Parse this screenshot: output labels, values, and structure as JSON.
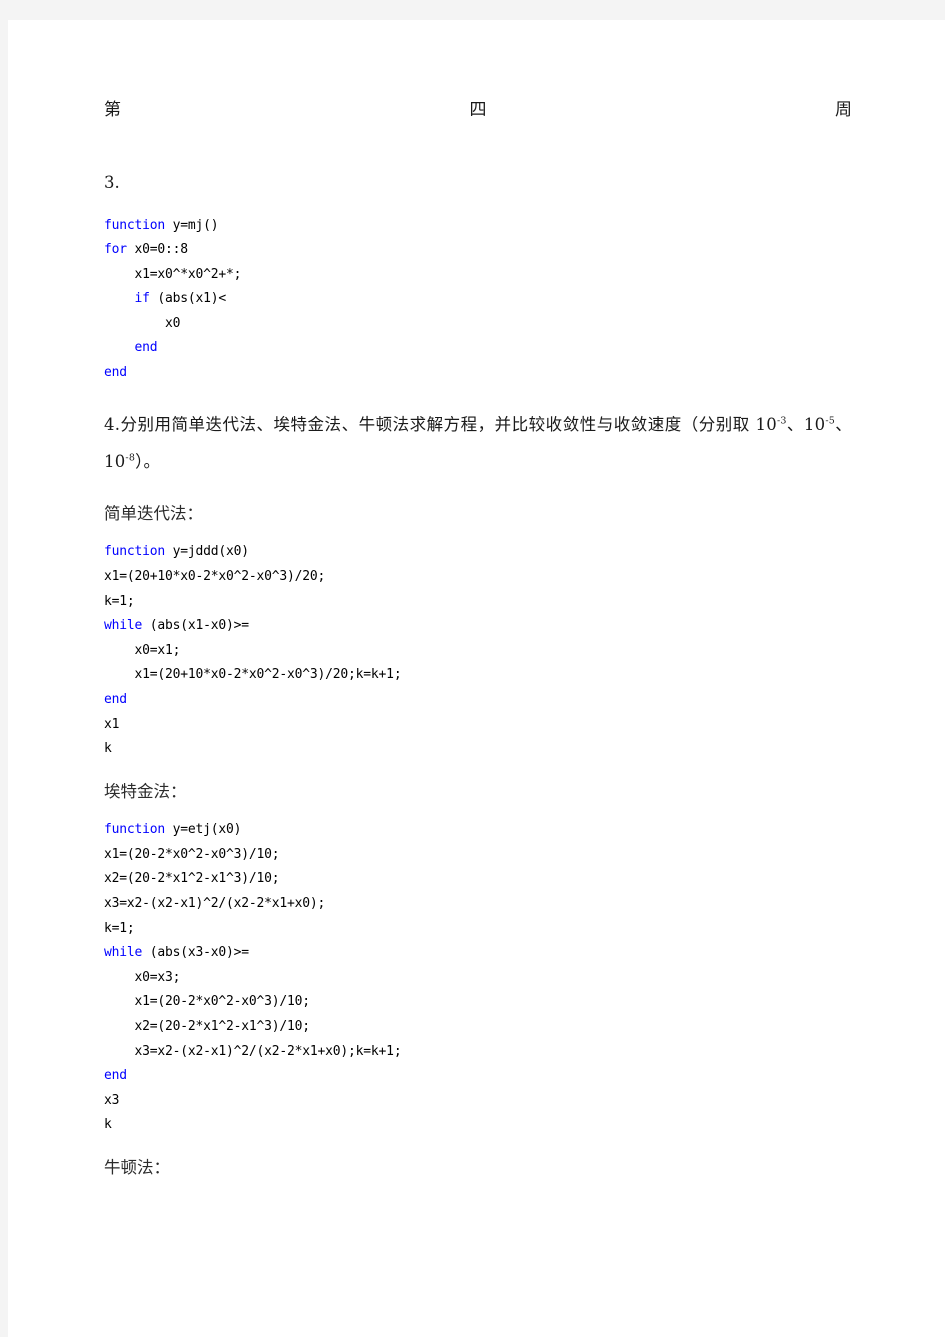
{
  "header": {
    "left": "第",
    "center": "四",
    "right": "周"
  },
  "sections": {
    "item3_number": "3.",
    "item3_code": [
      [
        {
          "t": "function",
          "k": true
        },
        {
          "t": " y=mj()",
          "k": false
        }
      ],
      [
        {
          "t": "for",
          "k": true
        },
        {
          "t": " x0=0::8",
          "k": false
        }
      ],
      [
        {
          "t": "    x1=x0^*x0^2+*;",
          "k": false
        }
      ],
      [
        {
          "t": "    ",
          "k": false
        },
        {
          "t": "if",
          "k": true
        },
        {
          "t": " (abs(x1)<",
          "k": false
        }
      ],
      [
        {
          "t": "        x0",
          "k": false
        }
      ],
      [
        {
          "t": "    ",
          "k": false
        },
        {
          "t": "end",
          "k": true
        }
      ],
      [
        {
          "t": "end",
          "k": true
        }
      ]
    ],
    "item4_text_part1": "4.分别用简单迭代法、埃特金法、牛顿法求解方程，并比较收敛性与收敛速度（分别取 10",
    "item4_sup1": "-3",
    "item4_mid1": "、10",
    "item4_sup2": "-5",
    "item4_mid2": "、10",
    "item4_sup3": "-8",
    "item4_text_end": "）。",
    "simple_iteration_heading": "简单迭代法：",
    "simple_iteration_code": [
      [
        {
          "t": "function",
          "k": true
        },
        {
          "t": " y=jddd(x0)",
          "k": false
        }
      ],
      [
        {
          "t": "x1=(20+10*x0-2*x0^2-x0^3)/20;",
          "k": false
        }
      ],
      [
        {
          "t": "k=1;",
          "k": false
        }
      ],
      [
        {
          "t": "while",
          "k": true
        },
        {
          "t": " (abs(x1-x0)>=",
          "k": false
        }
      ],
      [
        {
          "t": "    x0=x1;",
          "k": false
        }
      ],
      [
        {
          "t": "    x1=(20+10*x0-2*x0^2-x0^3)/20;k=k+1;",
          "k": false
        }
      ],
      [
        {
          "t": "end",
          "k": true
        }
      ],
      [
        {
          "t": "x1",
          "k": false
        }
      ],
      [
        {
          "t": "k",
          "k": false
        }
      ]
    ],
    "aitken_heading": "埃特金法：",
    "aitken_code": [
      [
        {
          "t": "function",
          "k": true
        },
        {
          "t": " y=etj(x0)",
          "k": false
        }
      ],
      [
        {
          "t": "x1=(20-2*x0^2-x0^3)/10;",
          "k": false
        }
      ],
      [
        {
          "t": "x2=(20-2*x1^2-x1^3)/10;",
          "k": false
        }
      ],
      [
        {
          "t": "x3=x2-(x2-x1)^2/(x2-2*x1+x0);",
          "k": false
        }
      ],
      [
        {
          "t": "k=1;",
          "k": false
        }
      ],
      [
        {
          "t": "while",
          "k": true
        },
        {
          "t": " (abs(x3-x0)>=",
          "k": false
        }
      ],
      [
        {
          "t": "    x0=x3;",
          "k": false
        }
      ],
      [
        {
          "t": "    x1=(20-2*x0^2-x0^3)/10;",
          "k": false
        }
      ],
      [
        {
          "t": "    x2=(20-2*x1^2-x1^3)/10;",
          "k": false
        }
      ],
      [
        {
          "t": "    x3=x2-(x2-x1)^2/(x2-2*x1+x0);k=k+1;",
          "k": false
        }
      ],
      [
        {
          "t": "end",
          "k": true
        }
      ],
      [
        {
          "t": "x3",
          "k": false
        }
      ],
      [
        {
          "t": "k",
          "k": false
        }
      ]
    ],
    "newton_heading": "牛顿法："
  },
  "colors": {
    "keyword_blue": "#0000ff",
    "body_text": "#1a1a1a",
    "page_background": "#ffffff",
    "canvas_background": "#f4f4f4"
  }
}
